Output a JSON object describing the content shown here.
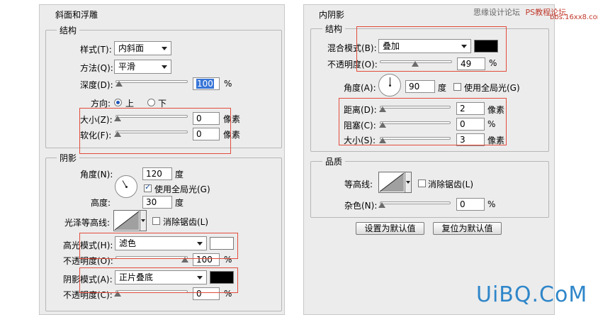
{
  "watermark": {
    "top": "思缘设计论坛",
    "site": "PS教程论坛",
    "domain": "bbs.16xx8.com",
    "bottom": "UiBQ.CoM"
  },
  "bevel": {
    "title": "斜面和浮雕",
    "structure": {
      "title": "结构",
      "style_label": "样式(T):",
      "style_value": "内斜面",
      "technique_label": "方法(Q):",
      "technique_value": "平滑",
      "depth_label": "深度(D):",
      "depth_value": "100",
      "depth_unit": "%",
      "depth_level_percent": 0,
      "direction_label": "方向:",
      "dir_up": "上",
      "dir_down": "下",
      "size_label": "大小(Z):",
      "size_value": "0",
      "size_unit": "像素",
      "size_level_percent": 0,
      "soften_label": "软化(F):",
      "soften_value": "0",
      "soften_unit": "像素",
      "soften_level_percent": 0
    },
    "shading": {
      "title": "阴影",
      "angle_label": "角度(N):",
      "angle_value": "120",
      "angle_unit": "度",
      "global_light_label": "使用全局光(G)",
      "altitude_label": "高度:",
      "altitude_value": "30",
      "altitude_unit": "度",
      "gloss_label": "光泽等高线:",
      "antialias_label": "消除锯齿(L)",
      "highlight_mode_label": "高光模式(H):",
      "highlight_mode_value": "滤色",
      "highlight_color": "#ffffff",
      "highlight_opacity_label": "不透明度(O):",
      "highlight_opacity_value": "100",
      "highlight_opacity_unit": "%",
      "highlight_opacity_percent": 100,
      "shadow_mode_label": "阴影模式(A):",
      "shadow_mode_value": "正片叠底",
      "shadow_color": "#000000",
      "shadow_opacity_label": "不透明度(C):",
      "shadow_opacity_value": "0",
      "shadow_opacity_unit": "%",
      "shadow_opacity_percent": 0
    }
  },
  "inner_shadow": {
    "title": "内阴影",
    "structure": {
      "title": "结构",
      "blend_label": "混合模式(B):",
      "blend_value": "叠加",
      "blend_color": "#000000",
      "opacity_label": "不透明度(O):",
      "opacity_value": "49",
      "opacity_unit": "%",
      "opacity_percent": 49,
      "angle_label": "角度(A):",
      "angle_value": "90",
      "angle_unit": "度",
      "global_light_label": "使用全局光(G)",
      "distance_label": "距离(D):",
      "distance_value": "2",
      "distance_unit": "像素",
      "distance_level_percent": 2,
      "choke_label": "阻塞(C):",
      "choke_value": "0",
      "choke_unit": "%",
      "choke_level_percent": 0,
      "size_label": "大小(S):",
      "size_value": "3",
      "size_unit": "像素",
      "size_level_percent": 2
    },
    "quality": {
      "title": "品质",
      "contour_label": "等高线:",
      "antialias_label": "消除锯齿(L)",
      "noise_label": "杂色(N):",
      "noise_value": "0",
      "noise_unit": "%",
      "noise_level_percent": 0
    },
    "buttons": {
      "make_default": "设置为默认值",
      "reset_default": "复位为默认值"
    }
  }
}
